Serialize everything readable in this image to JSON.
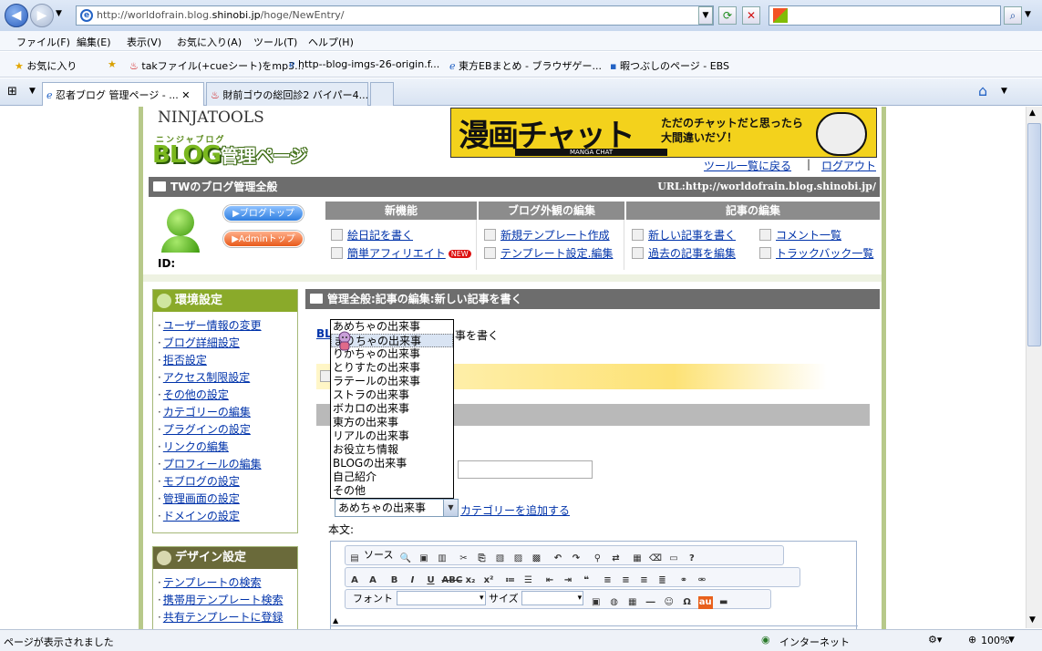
{
  "browser": {
    "url_prefix": "http://worldofrain.blog.",
    "url_host": "shinobi.jp",
    "url_path": "/hoge/NewEntry/",
    "menu": [
      "ファイル(F)",
      "編集(E)",
      "表示(V)",
      "お気に入り(A)",
      "ツール(T)",
      "ヘルプ(H)"
    ],
    "favorites_label": "お気に入り",
    "favorites": [
      "takファイル(+cueシート)をmp3...",
      "http--blog-imgs-26-origin.f...",
      "東方EBまとめ - ブラウザゲー...",
      "暇つぶしのページ - EBS"
    ],
    "tabs": [
      "忍者ブログ 管理ページ - ...",
      "財前ゴウの総回診2 バイパー4..."
    ],
    "status_text": "ページが表示されました",
    "zone_text": "インターネット",
    "zoom": "100%"
  },
  "site": {
    "logo_top": "NINJATOOLS",
    "logo_kana": "ニンジャブログ",
    "logo_main": "BLOG",
    "logo_sub": "管理ページ",
    "banner_main": "漫画チャット",
    "banner_sub1": "ただのチャットだと思ったら",
    "banner_sub2": "大間違いだゾ！",
    "banner_caption": "MANGA CHAT",
    "tool_list_link": "ツール一覧に戻る",
    "separator": "|",
    "logout_link": "ログアウト",
    "header_title": "TWのブログ管理全般",
    "header_url": "URL:http://worldofrain.blog.shinobi.jp/",
    "blog_top_btn": "▶ブログトップ",
    "admin_top_btn": "▶Adminトップ",
    "id_label": "ID:",
    "new_badge": "NEW"
  },
  "sections": {
    "new_features": {
      "title": "新機能",
      "items": [
        "絵日記を書く",
        "簡単アフィリエイト"
      ]
    },
    "design": {
      "title": "ブログ外観の編集",
      "items": [
        "新規テンプレート作成",
        "テンプレート設定.編集"
      ]
    },
    "articles": {
      "title": "記事の編集",
      "items": [
        "新しい記事を書く",
        "過去の記事を編集",
        "コメント一覧",
        "トラックバック一覧"
      ]
    }
  },
  "env_settings": {
    "title": "環境設定",
    "items": [
      "ユーザー情報の変更",
      "ブログ詳細設定",
      "拒否設定",
      "アクセス制限設定",
      "その他の設定",
      "カテゴリーの編集",
      "プラグインの設定",
      "リンクの編集",
      "プロフィールの編集",
      "モブログの設定",
      "管理画面の設定",
      "ドメインの設定"
    ]
  },
  "design_settings": {
    "title": "デザイン設定",
    "items": [
      "テンプレートの検索",
      "携帯用テンプレート検索",
      "共有テンプレートに登録"
    ]
  },
  "main": {
    "title": "管理全般:記事の編集:新しい記事を書く",
    "breadcrumb_link": "BLO",
    "breadcrumb_tail": "事を書く",
    "category_selected": "あめちゃの出来事",
    "add_category_link": "カテゴリーを追加する",
    "body_label": "本文:",
    "category_options": [
      "あめちゃの出来事",
      "まりちゃの出来事",
      "りかちゃの出来事",
      "とりすたの出来事",
      "ラテールの出来事",
      "ストラの出来事",
      "ボカロの出来事",
      "東方の出来事",
      "リアルの出来事",
      "お役立ち情報",
      "BLOGの出来事",
      "自己紹介",
      "その他"
    ],
    "highlighted_index": 1
  },
  "editor": {
    "source_label": "ソース",
    "font_label": "フォント",
    "size_label": "サイズ"
  }
}
